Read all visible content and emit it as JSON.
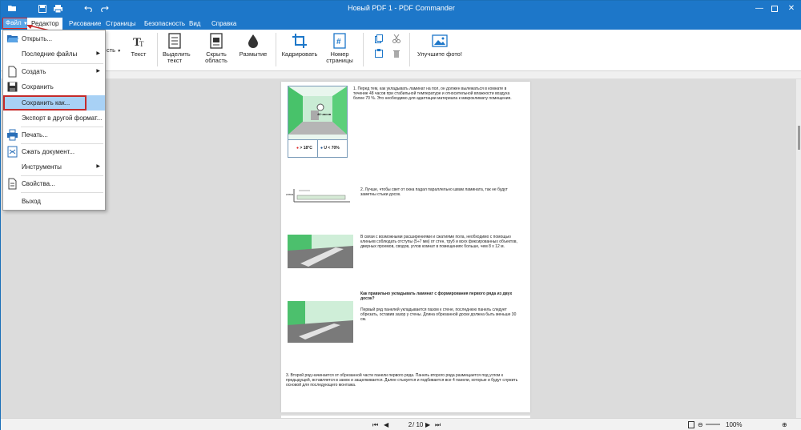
{
  "window": {
    "title": "Новый PDF 1 - PDF Commander"
  },
  "tabs": [
    {
      "label": "Файл"
    },
    {
      "label": "Редактор"
    },
    {
      "label": "Рисование"
    },
    {
      "label": "Страницы"
    },
    {
      "label": "Безопасность"
    },
    {
      "label": "Вид"
    },
    {
      "label": "Справка"
    }
  ],
  "ribbon": {
    "partial_label": "сть",
    "text": "Текст",
    "select_text_1": "Выделить",
    "select_text_2": "текст",
    "hide_area_1": "Скрыть",
    "hide_area_2": "область",
    "blur": "Размытие",
    "crop": "Кадрировать",
    "page_number_1": "Номер",
    "page_number_2": "страницы",
    "improve_photo": "Улучшите фото!"
  },
  "file_menu": {
    "items": [
      {
        "label": "Открыть..."
      },
      {
        "label": "Последние файлы"
      },
      {
        "label": "Создать"
      },
      {
        "label": "Сохранить"
      },
      {
        "label": "Сохранить как..."
      },
      {
        "label": "Экспорт в другой формат..."
      },
      {
        "label": "Печать..."
      },
      {
        "label": "Сжать документ..."
      },
      {
        "label": "Инструменты"
      },
      {
        "label": "Свойства..."
      },
      {
        "label": "Выход"
      }
    ]
  },
  "document": {
    "p1": "1. Перед тем, как укладывать ламинат на пол, он должен вылежаться в комнате в течение 48 часов при стабильной температуре и относительной влажности воздуха более 70 %. Это необходимо для адаптации материала к микроклимату помещения.",
    "p2": "2. Лучше, чтобы свет от окна падал параллельно швам ламината, так не будут заметны стыки досок.",
    "p3": "В связи с возможными расширениями и сжатиями пола, необходимо с помощью клиньев соблюдать отступы (5÷7 мм) от стен, труб и всех фиксированных объектов, дверных проемов, сводов, углов комнат в помещениях больше, чем 8 х 12 м.",
    "p4_title": "Как правильно укладывать ламинат с формирования первого ряда из двух досок?",
    "p4": "Первый ряд панелей укладывается пазом к стене, последнюю панель следует обрезать, оставив зазор у стены. Длина обрезанной доски должна быть меньше 30 см.",
    "p5": "3. Второй ряд начинается от обрезанной части панели первого ряда. Панель второго ряда размещается под углом к предыдущей, вставляется в замок и защелкивается. Далее стыкуется и подбивается все 4 панели, которые и будут служить основой для последующего монтажа.",
    "temp_label": "> 18°C",
    "humidity_label": "U < 70%",
    "hours_label": "48 часов",
    "wall_label": "стена"
  },
  "statusbar": {
    "page_current": "2",
    "page_total": "/ 10",
    "zoom": "100%"
  },
  "colors": {
    "titlebar": "#1d77c9",
    "highlight": "#a8d1f5",
    "annotation_red": "#c42b2b"
  }
}
